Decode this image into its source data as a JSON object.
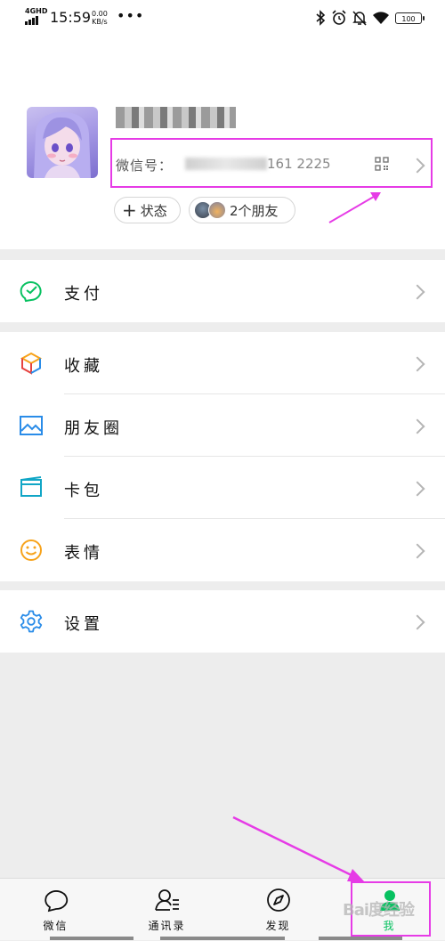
{
  "status_bar": {
    "network": "4GHD",
    "time": "15:59",
    "speed_value": "0.00",
    "speed_unit": "KB/s",
    "more": "•••",
    "battery": "100",
    "icons": [
      "bluetooth-icon",
      "alarm-icon",
      "mute-icon",
      "wifi-icon",
      "battery-icon"
    ]
  },
  "profile": {
    "wechat_id_label": "微信号：",
    "wechat_id_visible": "161 2225",
    "status_button": "状态",
    "friends_button": "2个朋友"
  },
  "menu": {
    "pay": "支付",
    "favorites": "收藏",
    "moments": "朋友圈",
    "cards": "卡包",
    "stickers": "表情",
    "settings": "设置"
  },
  "tabs": [
    {
      "label": "微信",
      "icon": "chat-bubble-icon"
    },
    {
      "label": "通讯录",
      "icon": "contacts-icon"
    },
    {
      "label": "发现",
      "icon": "compass-icon"
    },
    {
      "label": "我",
      "icon": "person-icon",
      "active": true
    }
  ],
  "watermark": "Bai度经验",
  "colors": {
    "accent": "#07c160",
    "annotation": "#e63be6"
  }
}
